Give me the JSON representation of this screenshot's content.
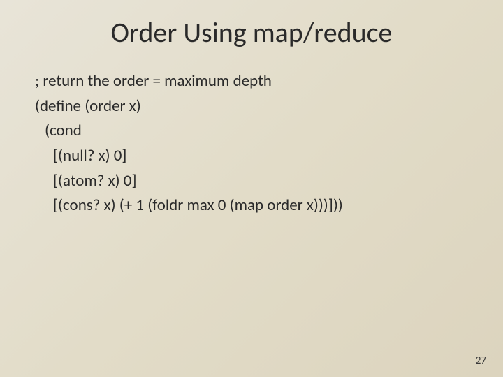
{
  "title": "Order Using map/reduce",
  "code": {
    "l1": "; return the order = maximum depth",
    "l2": "(define (order x)",
    "l3": "(cond",
    "l4": "[(null? x) 0]",
    "l5": "[(atom? x) 0]",
    "l6": "[(cons? x) (+ 1 (foldr max 0 (map order x)))]))"
  },
  "page_number": "27"
}
